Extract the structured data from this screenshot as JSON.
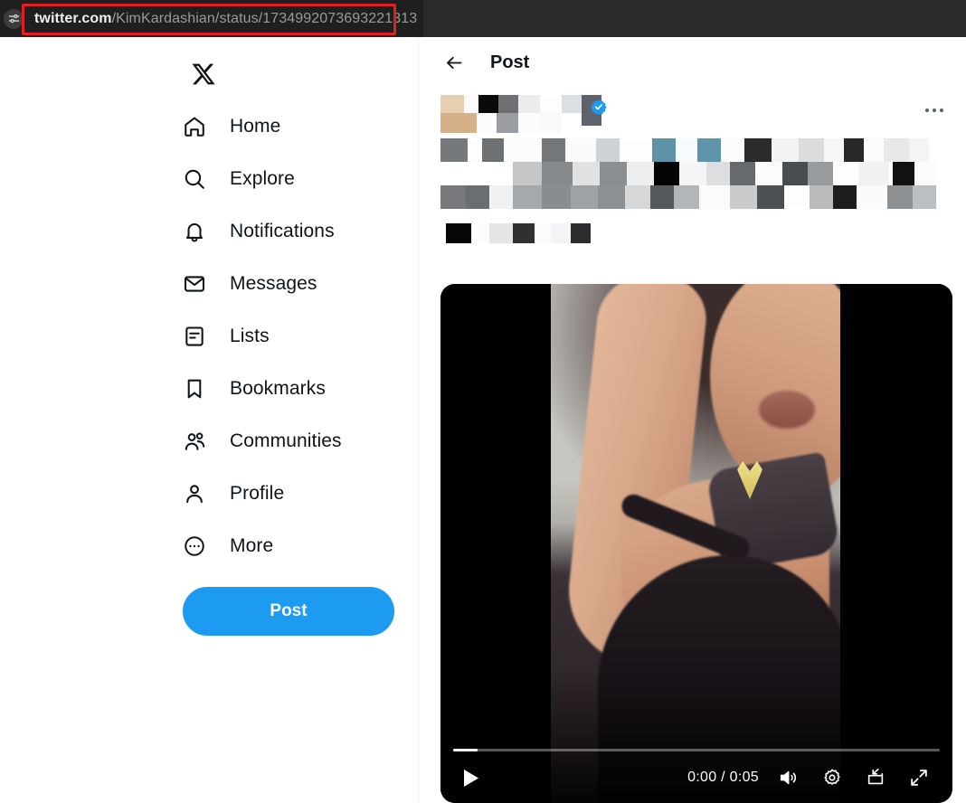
{
  "browser": {
    "site_info_icon": "tune-sliders-icon",
    "url_host": "twitter.com",
    "url_path": "/KimKardashian/status/1734992073693221313",
    "highlight_color": "#e02020"
  },
  "sidebar": {
    "logo": "x-logo",
    "items": [
      {
        "label": "Home",
        "icon": "home-icon"
      },
      {
        "label": "Explore",
        "icon": "search-icon"
      },
      {
        "label": "Notifications",
        "icon": "bell-icon"
      },
      {
        "label": "Messages",
        "icon": "envelope-icon"
      },
      {
        "label": "Lists",
        "icon": "list-icon"
      },
      {
        "label": "Bookmarks",
        "icon": "bookmark-icon"
      },
      {
        "label": "Communities",
        "icon": "people-icon"
      },
      {
        "label": "Profile",
        "icon": "person-icon"
      },
      {
        "label": "More",
        "icon": "more-circle-icon"
      }
    ],
    "post_button": "Post",
    "post_button_color": "#1d9bf0"
  },
  "main": {
    "back_icon": "back-arrow-icon",
    "title": "Post",
    "more_icon": "more-horizontal-icon",
    "author": {
      "name_redacted": true,
      "handle_redacted": true,
      "verified": true,
      "verified_icon": "verified-badge-icon",
      "verified_color": "#1d9bf0"
    },
    "tweet_text_redacted": true,
    "tweet_meta_redacted": true
  },
  "video": {
    "play_icon": "play-icon",
    "time_label": "0:00 / 0:05",
    "current_time": "0:00",
    "duration": "0:05",
    "progress_percent": 5,
    "volume_icon": "volume-icon",
    "settings_icon": "gear-icon",
    "pip_icon": "picture-in-picture-icon",
    "fullscreen_icon": "fullscreen-icon"
  }
}
